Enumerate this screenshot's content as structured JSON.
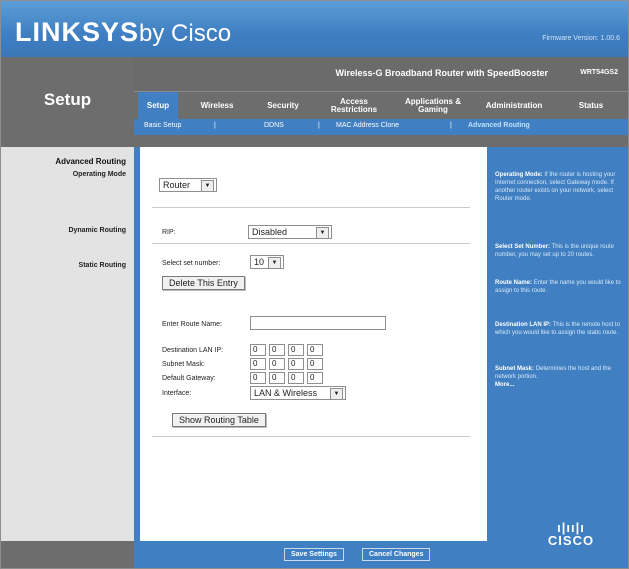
{
  "brand": {
    "logo": "LINKSYS",
    "by": "by Cisco",
    "firmware": "Firmware Version: 1.00.6"
  },
  "product": {
    "name": "Wireless-G Broadband Router with SpeedBooster",
    "model": "WRT54GS2"
  },
  "section": "Setup",
  "tabs": [
    {
      "label": "Setup"
    },
    {
      "label": "Wireless"
    },
    {
      "label": "Security"
    },
    {
      "label": "Access Restrictions"
    },
    {
      "label": "Applications & Gaming"
    },
    {
      "label": "Administration"
    },
    {
      "label": "Status"
    }
  ],
  "subtabs": [
    {
      "label": "Basic Setup"
    },
    {
      "label": "DDNS"
    },
    {
      "label": "MAC Address Clone"
    },
    {
      "label": "Advanced Routing"
    }
  ],
  "left": {
    "heading": "Advanced Routing",
    "operating_mode": "Operating Mode",
    "dynamic_routing": "Dynamic Routing",
    "static_routing": "Static Routing"
  },
  "form": {
    "operating_mode_value": "Router",
    "rip_label": "RIP:",
    "rip_value": "Disabled",
    "select_set_label": "Select set number:",
    "set_number_value": "10",
    "delete_entry": "Delete This Entry",
    "route_name_label": "Enter Route Name:",
    "route_name_value": "",
    "dest_lan_ip_label": "Destination LAN IP:",
    "subnet_mask_label": "Subnet Mask:",
    "default_gateway_label": "Default Gateway:",
    "interface_label": "Interface:",
    "interface_value": "LAN & Wireless",
    "dest_ip": [
      "0",
      "0",
      "0",
      "0"
    ],
    "subnet": [
      "0",
      "0",
      "0",
      "0"
    ],
    "gateway": [
      "0",
      "0",
      "0",
      "0"
    ],
    "show_routing_table": "Show Routing Table"
  },
  "help": {
    "op_mode_title": "Operating Mode:",
    "op_mode_text": "If the router is hosting your Internet connection, select Gateway mode. If another router exists on your network, select Router mode.",
    "set_number_title": "Select Set Number:",
    "set_number_text": "This is the unique route number, you may set up to 20 routes.",
    "route_name_title": "Route Name:",
    "route_name_text": "Enter the name you would like to assign to this route.",
    "dest_lan_title": "Destination LAN IP:",
    "dest_lan_text": "This is the remote host to which you would like to assign the static route.",
    "subnet_title": "Subnet Mask:",
    "subnet_text": "Determines the host and the network portion.",
    "more": "More..."
  },
  "footer": {
    "save": "Save Settings",
    "cancel": "Cancel Changes"
  },
  "cisco": {
    "bars": "ı|ıı|ı",
    "word": "CISCO"
  }
}
